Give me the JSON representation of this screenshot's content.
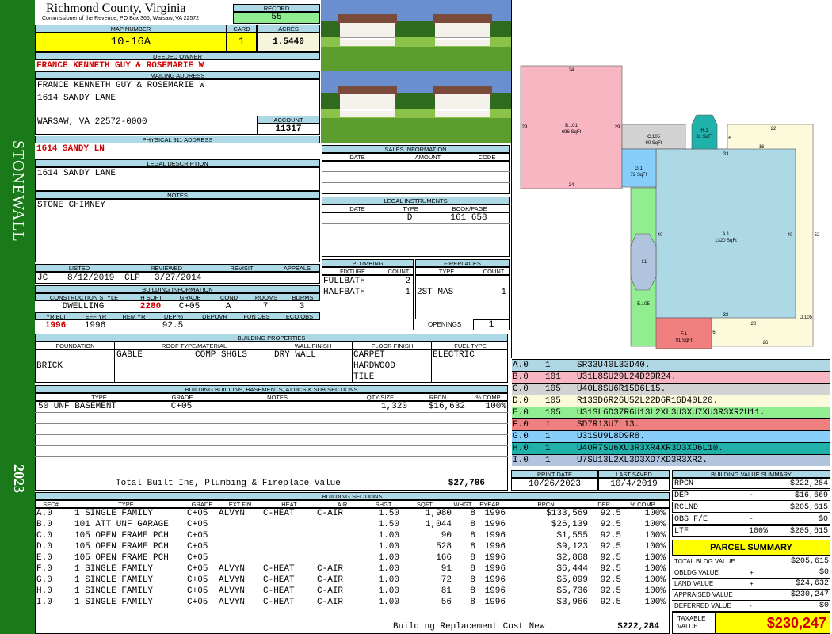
{
  "header": {
    "county": "Richmond County, Virginia",
    "commissioner": "Commissioner of the Revenue, PO Box 366, Warsaw, VA 22572",
    "record_label": "RECORD",
    "record": "55",
    "map_label": "MAP NUMBER",
    "map": "10-16A",
    "card_label": "CARD",
    "card": "1",
    "acres_label": "ACRES",
    "acres": "1.5440"
  },
  "side": {
    "district": "STONEWALL",
    "year": "2023"
  },
  "owner": {
    "deeded_label": "DEEDED OWNER",
    "deeded": "FRANCE KENNETH GUY & ROSEMARIE W",
    "mailing_label": "MAILING ADDRESS",
    "mail1": "FRANCE KENNETH GUY & ROSEMARIE W",
    "mail2": "1614 SANDY LANE",
    "mail3": "WARSAW, VA 22572-0000",
    "account_label": "ACCOUNT",
    "account": "11317",
    "phys_label": "PHYSICAL 911 ADDRESS",
    "phys": "1614 SANDY LN",
    "legal_label": "LEGAL DESCRIPTION",
    "legal": "1614 SANDY LANE",
    "notes_label": "NOTES",
    "notes": "STONE CHIMNEY"
  },
  "review": {
    "listed_label": "LISTED",
    "reviewed_label": "REVIEWED",
    "revisit_label": "REVISIT",
    "appeals_label": "APPEALS",
    "listed_by": "JC",
    "listed_date": "8/12/2019",
    "reviewed_by": "CLP",
    "reviewed_date": "3/27/2014"
  },
  "building_info": {
    "label": "BUILDING INFORMATION",
    "h": [
      "CONSTRUCTION STYLE",
      "H SQFT",
      "GRADE",
      "COND",
      "ROOMS",
      "BDRMS"
    ],
    "v": [
      "DWELLING",
      "2280",
      "C+05",
      "A",
      "7",
      "3"
    ],
    "h2": [
      "YR BLT",
      "EFF YR",
      "REM YR",
      "DEP %",
      "DEPOVR",
      "FUN OBS",
      "ECO OBS"
    ],
    "v2": [
      "1996",
      "1996",
      "",
      "92.5",
      "",
      "",
      ""
    ]
  },
  "sales": {
    "label": "SALES INFORMATION",
    "h": [
      "DATE",
      "AMOUNT",
      "CODE"
    ]
  },
  "legal_inst": {
    "label": "LEGAL INSTRUMENTS",
    "h": [
      "DATE",
      "TYPE",
      "BOOK/PAGE"
    ],
    "type": "D",
    "book": "161 658"
  },
  "plumbing": {
    "label": "PLUMBING",
    "h": [
      "FIXTURE",
      "COUNT"
    ],
    "r1": [
      "FULLBATH",
      "2"
    ],
    "r2": [
      "HALFBATH",
      "1"
    ]
  },
  "fireplaces": {
    "label": "FIREPLACES",
    "h": [
      "TYPE",
      "COUNT"
    ],
    "r1": [
      "2ST MAS",
      "1"
    ],
    "openings_label": "OPENINGS",
    "openings": "1"
  },
  "props": {
    "label": "BUILDING PROPERTIES",
    "h": [
      "FOUNDATION",
      "ROOF TYPE/MATERIAL",
      "WALL FINISH",
      "FLOOR FINISH",
      "FUEL TYPE"
    ],
    "foundation": "BRICK",
    "roof1": "GABLE",
    "roof2": "COMP SHGLS",
    "wall": "DRY WALL",
    "floor1": "CARPET",
    "floor2": "HARDWOOD",
    "floor3": "TILE",
    "fuel": "ELECTRIC"
  },
  "builtins": {
    "label": "BUILDING BUILT INS, BASEMENTS, ATTICS & SUB SECTIONS",
    "h": [
      "TYPE",
      "GRADE",
      "NOTES",
      "QTY/SIZE",
      "RPCN",
      "% COMP"
    ],
    "row": [
      "50 UNF BASEMENT",
      "C+05",
      "",
      "1,320",
      "$16,632",
      "100%"
    ],
    "total_label": "Total Built Ins, Plumbing & Fireplace Value",
    "total": "$27,786"
  },
  "dates": {
    "print_label": "PRINT DATE",
    "saved_label": "LAST SAVED",
    "print": "10/26/2023",
    "saved": "10/4/2019"
  },
  "sections": {
    "label": "BUILDING SECTIONS",
    "h": [
      "SEC#",
      "TYPE",
      "GRADE",
      "EXT FIN",
      "HEAT",
      "AIR",
      "SHGT",
      "SQFT",
      "WHGT",
      "EYEAR",
      "RPCN",
      "DEP",
      "% COMP"
    ],
    "rows": [
      [
        "A.0",
        "1 SINGLE FAMILY",
        "C+05",
        "ALVYN",
        "C-HEAT",
        "C-AIR",
        "1.50",
        "1,980",
        "8",
        "1996",
        "$133,569",
        "92.5",
        "100%"
      ],
      [
        "B.0",
        "101 ATT UNF GARAGE",
        "C+05",
        "",
        "",
        "",
        "1.50",
        "1,044",
        "8",
        "1996",
        "$26,139",
        "92.5",
        "100%"
      ],
      [
        "C.0",
        "105 OPEN FRAME PCH",
        "C+05",
        "",
        "",
        "",
        "1.00",
        "90",
        "8",
        "1996",
        "$1,555",
        "92.5",
        "100%"
      ],
      [
        "D.0",
        "105 OPEN FRAME PCH",
        "C+05",
        "",
        "",
        "",
        "1.00",
        "528",
        "8",
        "1996",
        "$9,123",
        "92.5",
        "100%"
      ],
      [
        "E.0",
        "105 OPEN FRAME PCH",
        "C+05",
        "",
        "",
        "",
        "1.00",
        "166",
        "8",
        "1996",
        "$2,868",
        "92.5",
        "100%"
      ],
      [
        "F.0",
        "1 SINGLE FAMILY",
        "C+05",
        "ALVYN",
        "C-HEAT",
        "C-AIR",
        "1.00",
        "91",
        "8",
        "1996",
        "$6,444",
        "92.5",
        "100%"
      ],
      [
        "G.0",
        "1 SINGLE FAMILY",
        "C+05",
        "ALVYN",
        "C-HEAT",
        "C-AIR",
        "1.00",
        "72",
        "8",
        "1996",
        "$5,099",
        "92.5",
        "100%"
      ],
      [
        "H.0",
        "1 SINGLE FAMILY",
        "C+05",
        "ALVYN",
        "C-HEAT",
        "C-AIR",
        "1.00",
        "81",
        "8",
        "1996",
        "$5,736",
        "92.5",
        "100%"
      ],
      [
        "I.0",
        "1 SINGLE FAMILY",
        "C+05",
        "ALVYN",
        "C-HEAT",
        "C-AIR",
        "1.00",
        "56",
        "8",
        "1996",
        "$3,966",
        "92.5",
        "100%"
      ]
    ],
    "total_label": "Building Replacement Cost New",
    "total": "$222,284"
  },
  "sketch_lines": [
    {
      "a": "A.0",
      "b": "1",
      "c": "SR33U40L33D40.",
      "color": "#b0d8e4"
    },
    {
      "a": "B.0",
      "b": "101",
      "c": "U31L8SU29L24D29R24.",
      "color": "#f7b6c2"
    },
    {
      "a": "C.0",
      "b": "105",
      "c": "U40L8SU6R15D6L15.",
      "color": "#d3d3d3"
    },
    {
      "a": "D.0",
      "b": "105",
      "c": "R13SD6R26U52L22D6R16D40L20.",
      "color": "#fdfadc"
    },
    {
      "a": "E.0",
      "b": "105",
      "c": "U31SL6D37R6U13L2XL3U3XU7XU3R3XR2U11.",
      "color": "#90ee90"
    },
    {
      "a": "F.0",
      "b": "1",
      "c": "SD7R13U7L13.",
      "color": "#f08080"
    },
    {
      "a": "G.0",
      "b": "1",
      "c": "U31SU9L8D9R8.",
      "color": "#87cefa"
    },
    {
      "a": "H.0",
      "b": "1",
      "c": "U40R7SU6XU3R3XR4XR3D3XD6L10.",
      "color": "#20b2aa"
    },
    {
      "a": "I.0",
      "b": "1",
      "c": "U7SU13L2XL3D3XD7XD3R3XR2.",
      "color": "#b0c4de"
    }
  ],
  "sketch": {
    "labels": [
      {
        "t": "B.101",
        "t2": "696 SqFt"
      },
      {
        "t": "C.105",
        "t2": "90 SqFt"
      },
      {
        "t": "H.1",
        "t2": "81 SqFt"
      },
      {
        "t": "G.1",
        "t2": "72 SqFt"
      },
      {
        "t": "A.1",
        "t2": "1320 SqFt"
      },
      {
        "t": "I.1",
        "t2": ""
      },
      {
        "t": "E.105",
        "t2": ""
      },
      {
        "t": "F.1",
        "t2": "91 SqFt"
      },
      {
        "t": "D.105",
        "t2": ""
      }
    ],
    "dims": [
      "24",
      "29",
      "29",
      "24",
      "22",
      "16",
      "6",
      "33",
      "40",
      "40",
      "52",
      "33",
      "20",
      "6",
      "26"
    ]
  },
  "value_summary": {
    "label": "BUILDING VALUE SUMMARY",
    "rows": [
      {
        "k": "RPCN",
        "op": "",
        "v": "$222,284"
      },
      {
        "k": "DEP",
        "op": "-",
        "v": "$16,669"
      },
      {
        "k": "RCLND",
        "op": "",
        "v": "$205,615"
      },
      {
        "k": "OBS F/E",
        "op": "-",
        "v": "$0"
      },
      {
        "k": "LTF",
        "op": "100%",
        "v": "$205,615"
      }
    ]
  },
  "parcel": {
    "title": "PARCEL SUMMARY",
    "rows": [
      {
        "k": "TOTAL BLDG VALUE",
        "op": "",
        "v": "$205,615"
      },
      {
        "k": "OBLDG VALUE",
        "op": "+",
        "v": "$0"
      },
      {
        "k": "LAND VALUE",
        "op": "+",
        "v": "$24,632"
      },
      {
        "k": "APPRAISED VALUE",
        "op": "",
        "v": "$230,247"
      },
      {
        "k": "DEFERRED VALUE",
        "op": "-",
        "v": "$0"
      }
    ],
    "taxable_label": "TAXABLE VALUE",
    "taxable": "$230,247"
  },
  "colors": {
    "green": "#1a7a1a",
    "label_blue": "#add8e6",
    "yellow": "#ffff00",
    "record_green": "#90ee90",
    "red": "#d00000"
  }
}
